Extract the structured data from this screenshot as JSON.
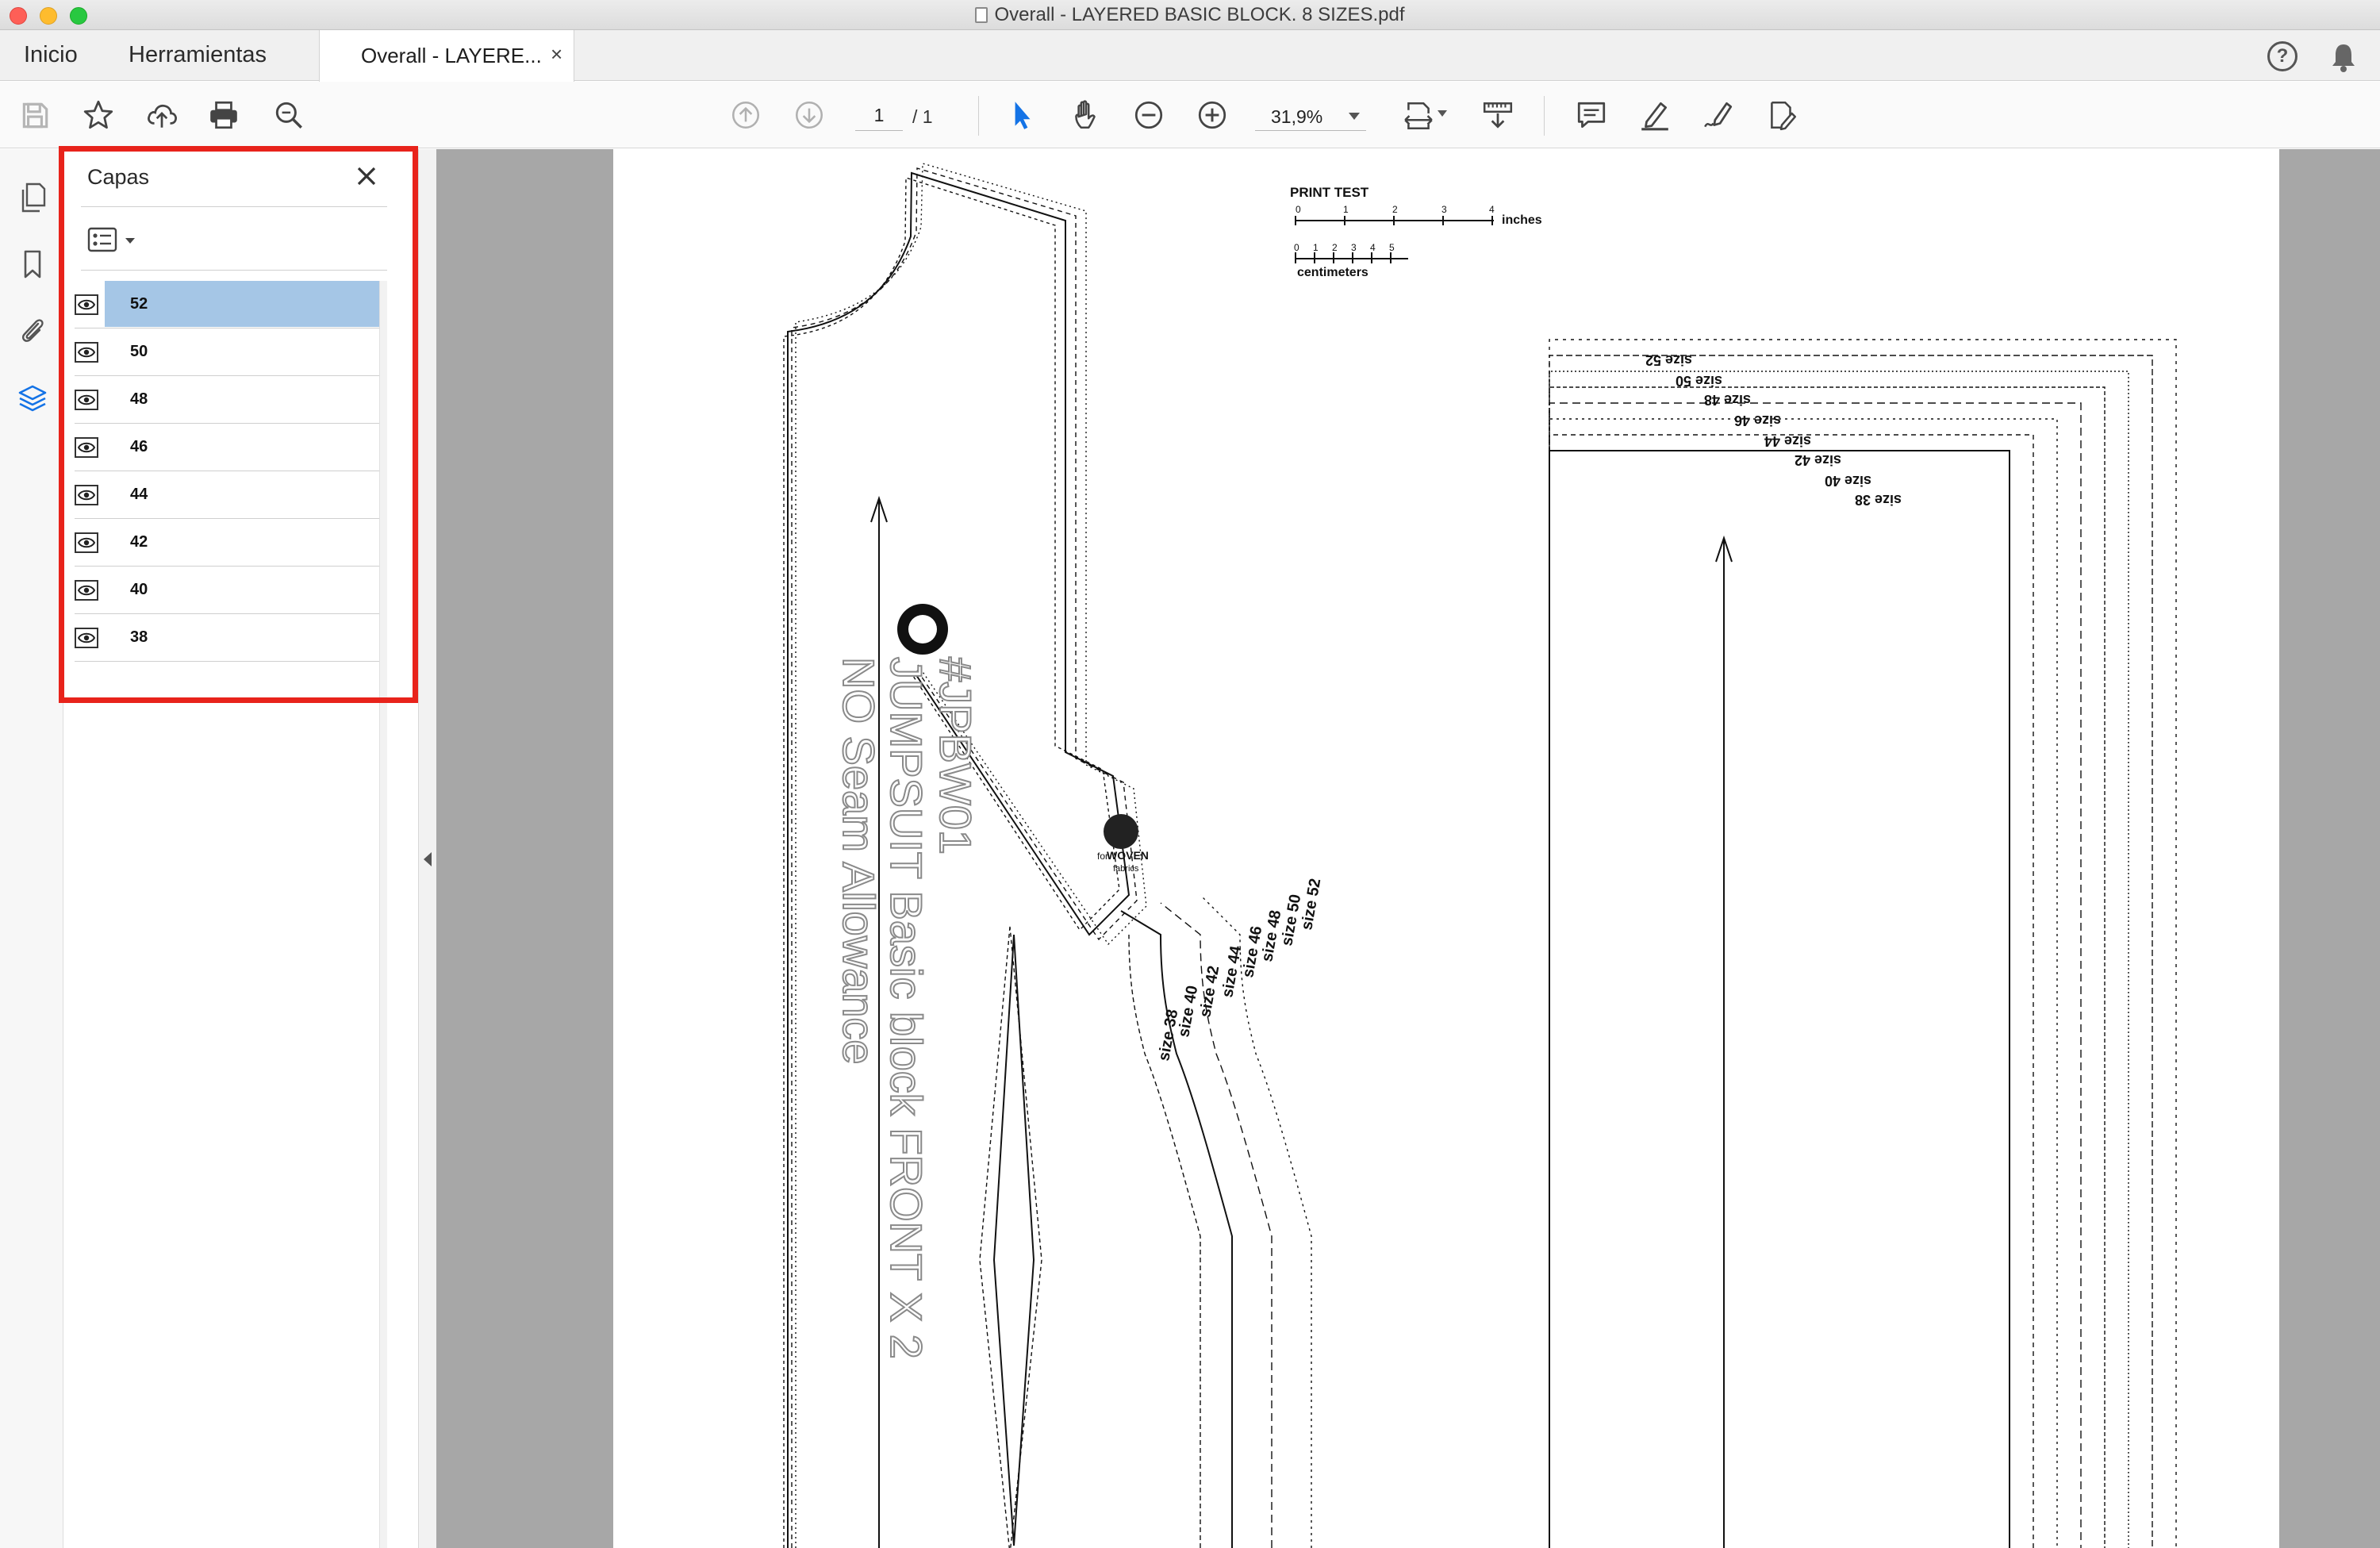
{
  "window": {
    "title": "Overall - LAYERED BASIC BLOCK. 8 SIZES.pdf"
  },
  "tabs": {
    "home": "Inicio",
    "tools": "Herramientas",
    "document": "Overall - LAYERE...",
    "close_glyph": "×"
  },
  "toolbar": {
    "page_current": "1",
    "page_total": "/ 1",
    "zoom": "31,9%",
    "icons": [
      "save-icon",
      "star-icon",
      "cloud-upload-icon",
      "print-icon",
      "zoom-search-icon",
      "page-up-icon",
      "page-down-icon",
      "select-pointer-icon",
      "hand-icon",
      "zoom-out-icon",
      "zoom-in-icon",
      "fit-page-icon",
      "scroll-mode-icon",
      "comment-icon",
      "highlight-pen-icon",
      "sign-icon",
      "edit-icon"
    ]
  },
  "rail": {
    "icons": [
      "pages-icon",
      "bookmark-icon",
      "attachment-icon",
      "layers-icon"
    ]
  },
  "layers_panel": {
    "title": "Capas",
    "selected": "52",
    "layers": [
      {
        "label": "52"
      },
      {
        "label": "50"
      },
      {
        "label": "48"
      },
      {
        "label": "46"
      },
      {
        "label": "44"
      },
      {
        "label": "42"
      },
      {
        "label": "40"
      },
      {
        "label": "38"
      }
    ]
  },
  "document": {
    "print_test_label": "PRINT TEST",
    "inches_label": "inches",
    "inch_ticks": [
      "0",
      "1",
      "2",
      "3",
      "4"
    ],
    "centimeters_label": "centimeters",
    "cm_ticks": [
      "0",
      "1",
      "2",
      "3",
      "4",
      "5"
    ],
    "pattern_code": "#JPBW01",
    "pattern_name": "JUMPSUIT Basic block FRONT X 2",
    "seam_note": "NO Seam Allowance",
    "woven_for": "for",
    "woven_label": "WOVEN",
    "woven_sub": "fabrics",
    "size_labels_side": [
      "size 38",
      "size 40",
      "size 42",
      "size 44",
      "size 46",
      "size 48",
      "size 50",
      "size 52"
    ],
    "size_labels_top": [
      "size 52",
      "size 50",
      "size 48",
      "size 46",
      "size 44",
      "size 42",
      "size 40",
      "size 38"
    ]
  }
}
